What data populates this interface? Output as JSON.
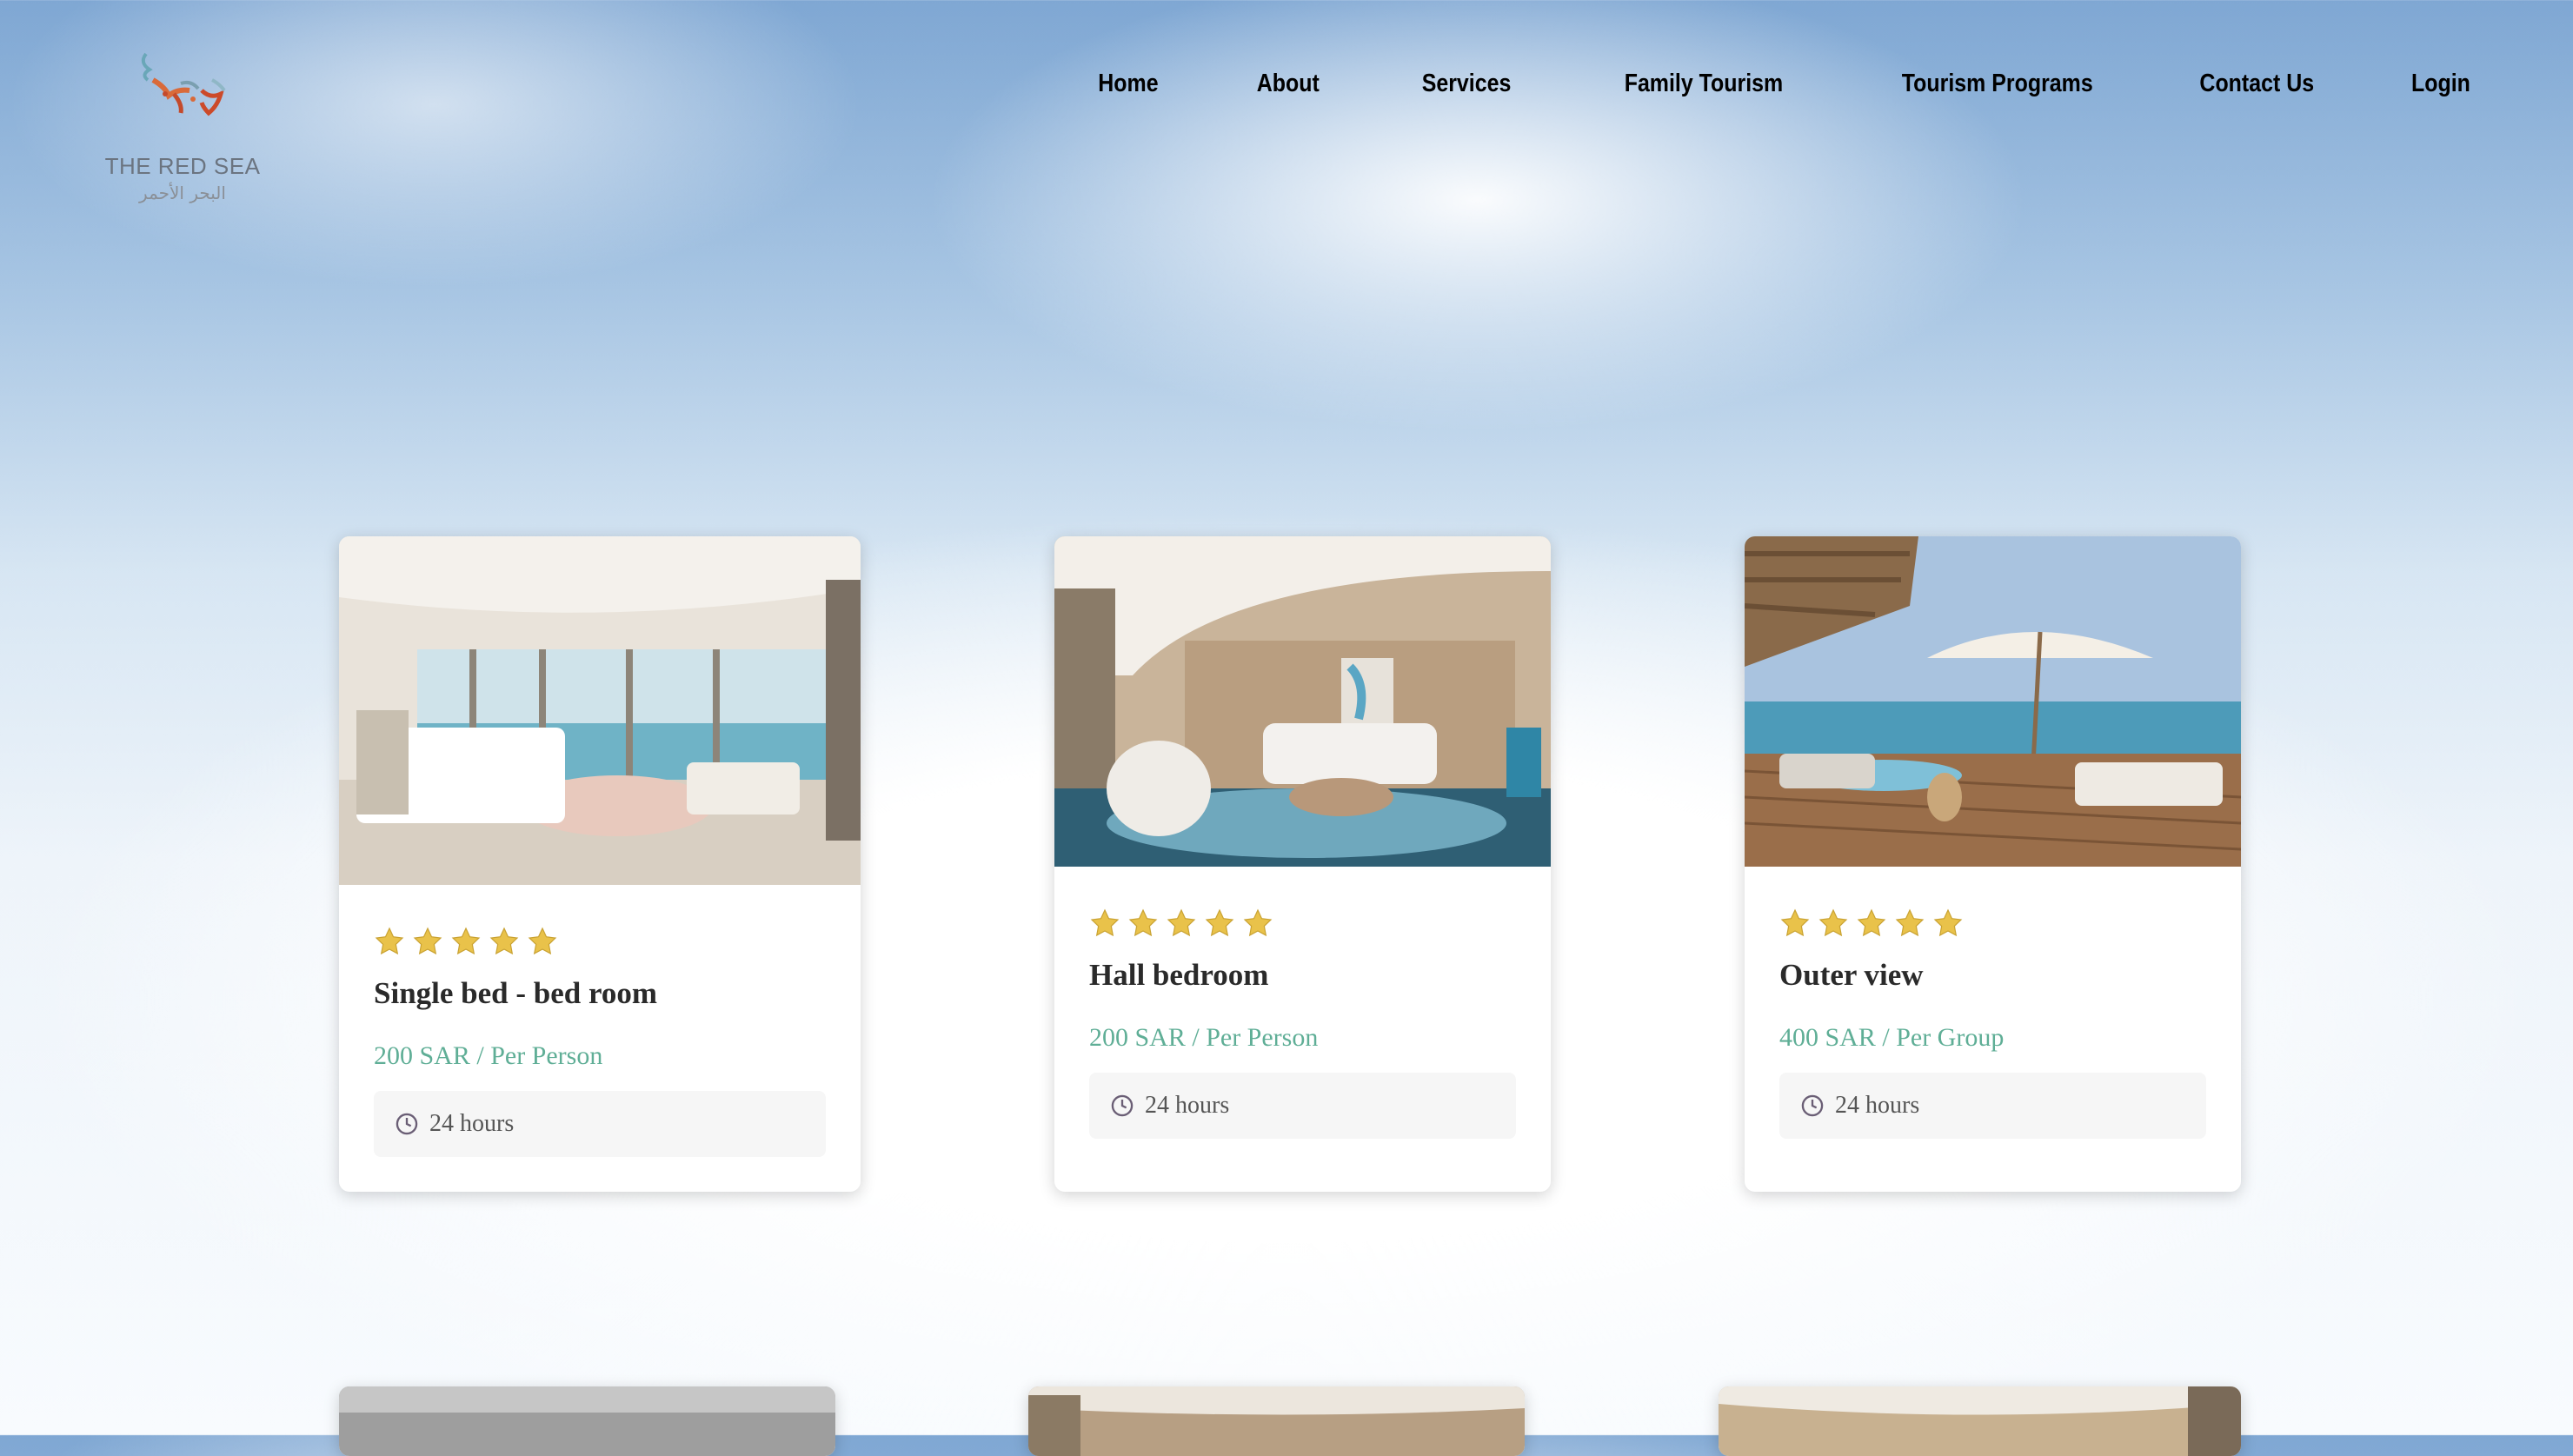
{
  "brand": {
    "name_en": "THE RED SEA",
    "name_ar": "البحر الأحمر",
    "logo_icon": "red-sea-logo-icon"
  },
  "nav": {
    "items": [
      {
        "label": "Home"
      },
      {
        "label": "About"
      },
      {
        "label": "Services"
      },
      {
        "label": "Family Tourism"
      },
      {
        "label": "Tourism Programs"
      },
      {
        "label": "Contact Us"
      },
      {
        "label": "Login"
      }
    ]
  },
  "colors": {
    "price": "#5fae96",
    "star": "#e9c24a",
    "sky": "#7fa7d3"
  },
  "cards": [
    {
      "title": "Single bed - bed room",
      "price": "200 SAR / Per Person",
      "duration": "24 hours",
      "rating": 5,
      "image": "bedroom-sea-view-image"
    },
    {
      "title": "Hall bedroom",
      "price": "200 SAR / Per Person",
      "duration": "24 hours",
      "rating": 5,
      "image": "living-hall-image"
    },
    {
      "title": "Outer view",
      "price": "400 SAR / Per Group",
      "duration": "24 hours",
      "rating": 5,
      "image": "deck-pool-umbrella-image"
    }
  ],
  "icons": {
    "star": "star-icon",
    "clock": "clock-icon"
  }
}
